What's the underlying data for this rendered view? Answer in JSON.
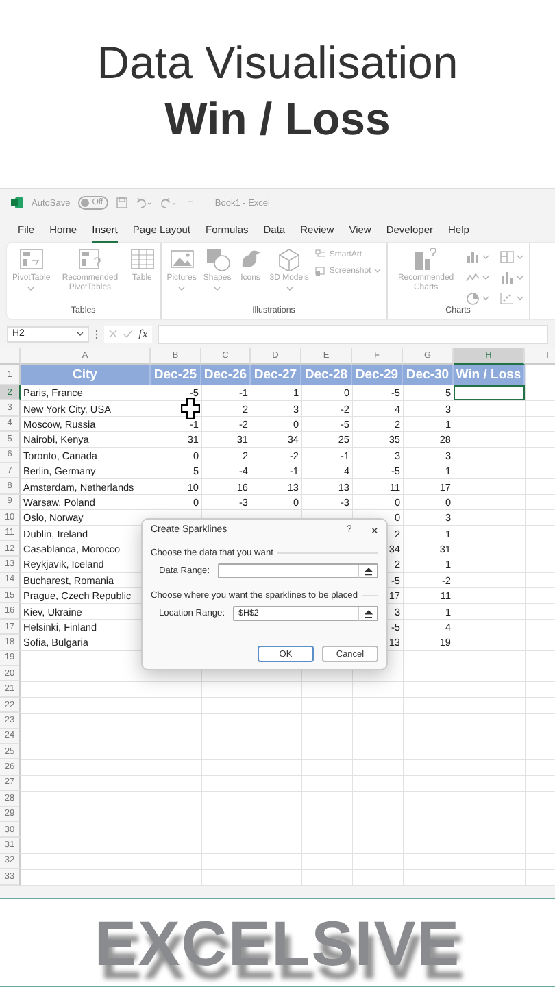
{
  "header": {
    "title": "Data Visualisation",
    "subtitle": "Win / Loss"
  },
  "excel": {
    "title_bar": {
      "autosave": {
        "label": "AutoSave",
        "state": "Off",
        "on": false
      },
      "quick_access": "=",
      "title": "Book1 - Excel"
    },
    "menu_tabs": [
      {
        "label": "File",
        "selected": false
      },
      {
        "label": "Home",
        "selected": false
      },
      {
        "label": "Insert",
        "selected": true
      },
      {
        "label": "Page Layout",
        "selected": false
      },
      {
        "label": "Formulas",
        "selected": false
      },
      {
        "label": "Data",
        "selected": false
      },
      {
        "label": "Review",
        "selected": false
      },
      {
        "label": "View",
        "selected": false
      },
      {
        "label": "Developer",
        "selected": false
      },
      {
        "label": "Help",
        "selected": false
      }
    ],
    "ribbon": {
      "disabled": true,
      "groups": [
        {
          "label": "Tables",
          "items": [
            {
              "kind": "pivot",
              "label": "PivotTable",
              "dropdown": true
            },
            {
              "kind": "recpivot",
              "label": "Recommended PivotTables",
              "dropdown": false
            },
            {
              "kind": "table",
              "label": "Table",
              "dropdown": false
            }
          ]
        },
        {
          "label": "Illustrations",
          "items": [
            {
              "kind": "pictures",
              "label": "Pictures",
              "dropdown": true
            },
            {
              "kind": "shapes",
              "label": "Shapes",
              "dropdown": true
            },
            {
              "kind": "icons",
              "label": "Icons",
              "dropdown": false
            },
            {
              "kind": "model3d",
              "label": "3D Models",
              "dropdown": true
            },
            {
              "kind": "small",
              "label": "SmartArt",
              "dropdown": false
            },
            {
              "kind": "small",
              "label": "Screenshot",
              "dropdown": true
            }
          ]
        },
        {
          "label": "Charts",
          "items": [
            {
              "kind": "reccharts",
              "label": "Recommended Charts",
              "dropdown": false
            },
            {
              "kind": "minigrid"
            }
          ]
        }
      ]
    },
    "formula_bar": {
      "name_box": "H2",
      "function_icon": "fx"
    },
    "sheet": {
      "columns": [
        "A",
        "B",
        "C",
        "D",
        "E",
        "F",
        "G",
        "H",
        "I"
      ],
      "header_row": {
        "number": "1",
        "cells": [
          "City",
          "Dec-25",
          "Dec-26",
          "Dec-27",
          "Dec-28",
          "Dec-29",
          "Dec-30",
          "Win / Loss"
        ]
      },
      "rows": [
        {
          "number": "2",
          "city": "Paris, France",
          "b": "-5",
          "c": "-1",
          "d": "1",
          "e": "0",
          "f": "-5",
          "g": "5",
          "selected": true
        },
        {
          "number": "3",
          "city": "New York City, USA",
          "c": "2",
          "d": "3",
          "e": "-2",
          "f": "4",
          "g": "3",
          "selected": false
        },
        {
          "number": "4",
          "city": "Moscow, Russia",
          "b": "-1",
          "c": "-2",
          "d": "0",
          "e": "-5",
          "f": "2",
          "g": "1",
          "selected": false
        },
        {
          "number": "5",
          "city": "Nairobi, Kenya",
          "b": "31",
          "c": "31",
          "d": "34",
          "e": "25",
          "f": "35",
          "g": "28",
          "selected": false
        },
        {
          "number": "6",
          "city": "Toronto, Canada",
          "b": "0",
          "c": "2",
          "d": "-2",
          "e": "-1",
          "f": "3",
          "g": "3",
          "selected": false
        },
        {
          "number": "7",
          "city": "Berlin, Germany",
          "b": "5",
          "c": "-4",
          "d": "-1",
          "e": "4",
          "f": "-5",
          "g": "1",
          "selected": false
        },
        {
          "number": "8",
          "city": "Amsterdam, Netherlands",
          "b": "10",
          "c": "16",
          "d": "13",
          "e": "13",
          "f": "11",
          "g": "17",
          "selected": false
        },
        {
          "number": "9",
          "city": "Warsaw, Poland",
          "b": "0",
          "c": "-3",
          "d": "0",
          "e": "-3",
          "f": "0",
          "g": "0",
          "selected": false
        },
        {
          "number": "10",
          "city": "Oslo, Norway",
          "f": "0",
          "g": "3",
          "selected": false
        },
        {
          "number": "11",
          "city": "Dublin, Ireland",
          "f": "2",
          "g": "1",
          "selected": false
        },
        {
          "number": "12",
          "city": "Casablanca, Morocco",
          "f": "34",
          "g": "31",
          "selected": false
        },
        {
          "number": "13",
          "city": "Reykjavik, Iceland",
          "f": "2",
          "g": "1",
          "selected": false
        },
        {
          "number": "14",
          "city": "Bucharest, Romania",
          "f": "-5",
          "g": "-2",
          "selected": false
        },
        {
          "number": "15",
          "city": "Prague, Czech Republic",
          "f": "17",
          "g": "11",
          "selected": false
        },
        {
          "number": "16",
          "city": "Kiev, Ukraine",
          "f": "3",
          "g": "1",
          "selected": false
        },
        {
          "number": "17",
          "city": "Helsinki, Finland",
          "f": "-5",
          "g": "4",
          "selected": false
        },
        {
          "number": "18",
          "city": "Sofia, Bulgaria",
          "f": "13",
          "g": "19",
          "selected": false
        }
      ],
      "empty_rows": [
        "19",
        "20",
        "21",
        "22",
        "23",
        "24",
        "25",
        "26",
        "27",
        "28",
        "29",
        "30",
        "31",
        "32",
        "33"
      ]
    },
    "dialog": {
      "title": "Create Sparklines",
      "help": "?",
      "close": "×",
      "sections": [
        {
          "heading": "Choose the data that you want",
          "field": {
            "label": "Data Range:"
          }
        },
        {
          "heading": "Choose where you want the sparklines to be placed",
          "field": {
            "label": "Location Range:",
            "value": "$H$2"
          }
        }
      ],
      "buttons": [
        {
          "label": "OK",
          "default": true
        },
        {
          "label": "Cancel",
          "default": false
        }
      ]
    }
  },
  "brand": {
    "logo": "EXCELSIVE"
  }
}
